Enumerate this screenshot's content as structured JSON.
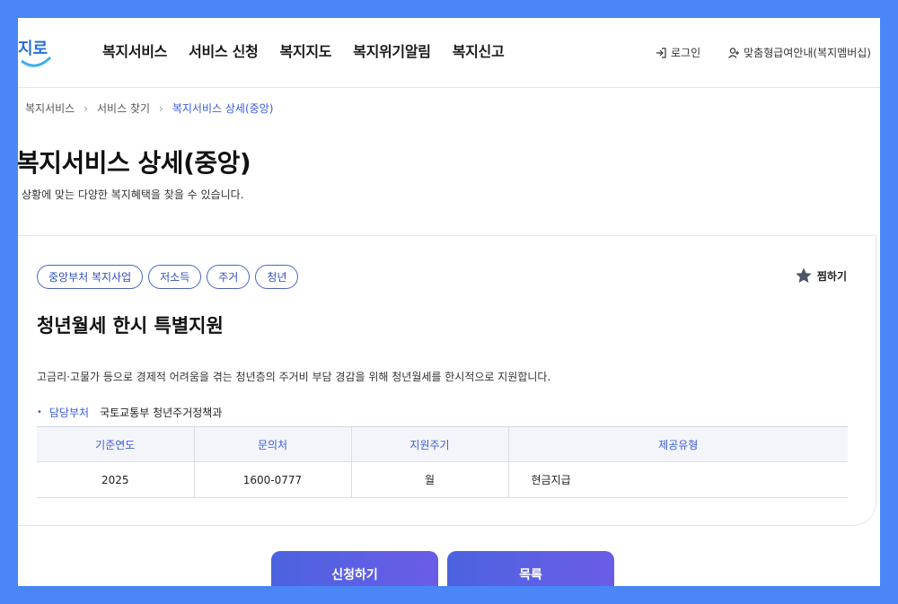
{
  "header": {
    "logo_text": "지로",
    "gnb": [
      "복지서비스",
      "서비스 신청",
      "복지지도",
      "복지위기알림",
      "복지신고"
    ],
    "util": {
      "login": "로그인",
      "guide": "맞춤형급여안내(복지멤버십)"
    }
  },
  "breadcrumb": [
    "복지서비스",
    "서비스 찾기",
    "복지서비스 상세(중앙)"
  ],
  "page": {
    "title": "복지서비스 상세(중앙)",
    "subtitle": "상황에 맞는 다양한 복지혜택을 찾을 수 있습니다."
  },
  "service": {
    "tags": [
      "중앙부처 복지사업",
      "저소득",
      "주거",
      "청년"
    ],
    "bookmark_label": "찜하기",
    "title": "청년월세 한시 특별지원",
    "description": "고금리·고물가 등으로 경제적 어려움을 겪는 청년층의 주거비 부담 경감을 위해 청년월세를 한시적으로 지원합니다.",
    "dept_label": "담당부처",
    "dept_value": "국토교통부 청년주거정책과",
    "table": {
      "headers": [
        "기준연도",
        "문의처",
        "지원주기",
        "제공유형"
      ],
      "row": [
        "2025",
        "1600-0777",
        "월",
        "현금지급"
      ]
    }
  },
  "buttons": {
    "apply": "신청하기",
    "list": "목록"
  },
  "colors": {
    "accent": "#3b5bdb",
    "frame": "#4a86f7",
    "button_start": "#4c63e0",
    "button_end": "#6b5ce6"
  }
}
